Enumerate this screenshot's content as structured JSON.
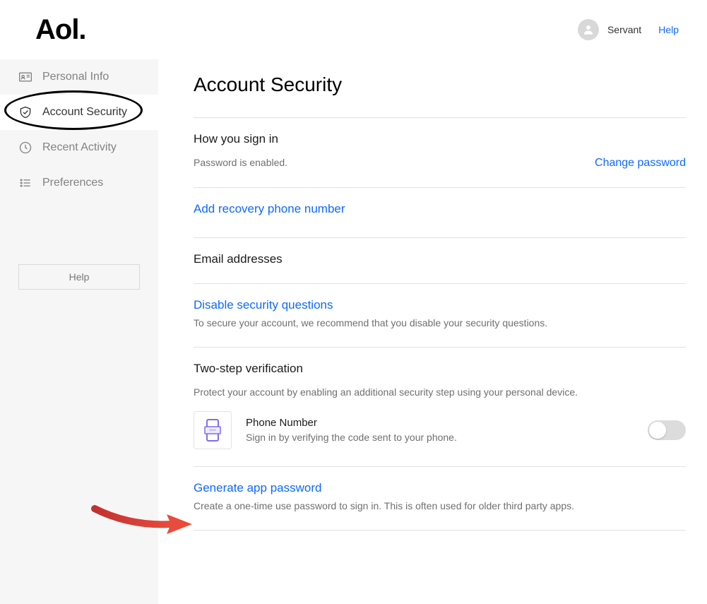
{
  "header": {
    "logo": "Aol.",
    "username": "Servant",
    "help_label": "Help"
  },
  "sidebar": {
    "items": [
      {
        "label": "Personal Info"
      },
      {
        "label": "Account Security"
      },
      {
        "label": "Recent Activity"
      },
      {
        "label": "Preferences"
      }
    ],
    "help_button": "Help"
  },
  "main": {
    "title": "Account Security",
    "signin": {
      "heading": "How you sign in",
      "status": "Password is enabled.",
      "change_label": "Change password"
    },
    "recovery": {
      "link": "Add recovery phone number"
    },
    "emails": {
      "heading": "Email addresses"
    },
    "secq": {
      "link": "Disable security questions",
      "desc": "To secure your account, we recommend that you disable your security questions."
    },
    "tsv": {
      "heading": "Two-step verification",
      "desc": "Protect your account by enabling an additional security step using your personal device.",
      "method_title": "Phone Number",
      "method_desc": "Sign in by verifying the code sent to your phone."
    },
    "apppw": {
      "link": "Generate app password",
      "desc": "Create a one-time use password to sign in. This is often used for older third party apps."
    }
  }
}
